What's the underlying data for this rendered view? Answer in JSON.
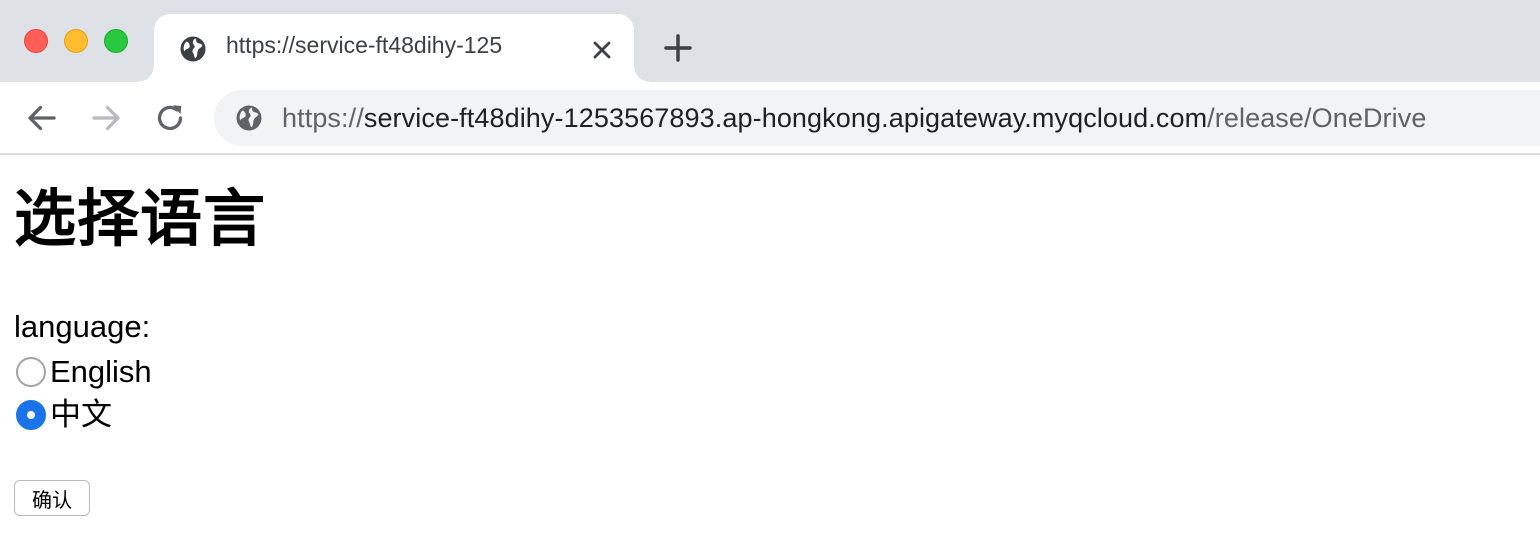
{
  "browser": {
    "window_controls": {
      "close_color": "#ff5f57",
      "minimize_color": "#febc2e",
      "maximize_color": "#28c840"
    },
    "tab": {
      "icon": "globe-icon",
      "title": "https://service-ft48dihy-125",
      "close_icon": "close-icon"
    },
    "new_tab_icon": "plus-icon",
    "nav": {
      "back_icon": "arrow-left-icon",
      "forward_icon": "arrow-right-icon",
      "reload_icon": "reload-icon"
    },
    "address_bar": {
      "icon": "globe-icon",
      "scheme": "https://",
      "host": "service-ft48dihy-1253567893.ap-hongkong.apigateway.myqcloud.com",
      "path": "/release/OneDrive"
    }
  },
  "page": {
    "title": "选择语言",
    "language_label": "language:",
    "options": [
      {
        "label": "English",
        "checked": false
      },
      {
        "label": "中文",
        "checked": true
      }
    ],
    "submit_label": "确认",
    "radio_checked_color": "#1a73e8"
  }
}
